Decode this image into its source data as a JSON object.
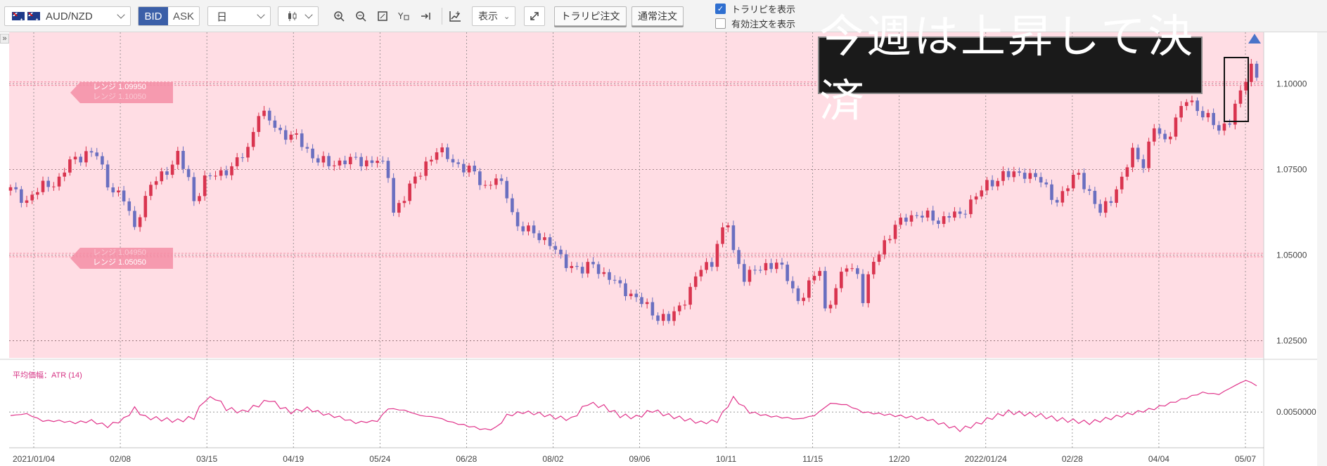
{
  "toolbar": {
    "pair": "AUD/NZD",
    "bid_label": "BID",
    "ask_label": "ASK",
    "timeframe": "日",
    "display_label": "表示",
    "trarepi_order_label": "トラリピ注文",
    "normal_order_label": "通常注文",
    "show_trarepi_label": "トラリピを表示",
    "show_trarepi_checked": true,
    "show_active_label": "有効注文を表示",
    "show_active_checked": false
  },
  "annotation": "今週は上昇して決済",
  "ranges": {
    "upper_top": "レンジ 1.09950",
    "upper_bottom": "レンジ 1.10050",
    "lower_top": "レンジ 1.04950",
    "lower_bottom": "レンジ 1.05050"
  },
  "chart_data": {
    "type": "candlestick",
    "symbol": "AUD/NZD",
    "timeframe": "日",
    "price_axis": {
      "min": 1.02,
      "max": 1.115,
      "ticks": [
        "1.02500",
        "1.05000",
        "1.07500",
        "1.10000"
      ]
    },
    "x_labels": [
      "2021/01/04",
      "02/08",
      "03/15",
      "04/19",
      "05/24",
      "06/28",
      "08/02",
      "09/06",
      "10/11",
      "11/15",
      "12/20",
      "2022/01/24",
      "02/28",
      "04/04",
      "05/07"
    ],
    "close_path": [
      [
        0,
        1.069
      ],
      [
        3,
        1.066
      ],
      [
        6,
        1.07
      ],
      [
        9,
        1.072
      ],
      [
        11,
        1.077
      ],
      [
        14,
        1.08
      ],
      [
        16,
        1.079
      ],
      [
        18,
        1.071
      ],
      [
        21,
        1.066
      ],
      [
        23,
        1.058
      ],
      [
        24,
        1.063
      ],
      [
        26,
        1.07
      ],
      [
        29,
        1.075
      ],
      [
        31,
        1.079
      ],
      [
        33,
        1.072
      ],
      [
        34,
        1.066
      ],
      [
        36,
        1.072
      ],
      [
        39,
        1.074
      ],
      [
        42,
        1.077
      ],
      [
        44,
        1.081
      ],
      [
        46,
        1.092
      ],
      [
        48,
        1.089
      ],
      [
        50,
        1.086
      ],
      [
        53,
        1.084
      ],
      [
        56,
        1.079
      ],
      [
        59,
        1.076
      ],
      [
        62,
        1.078
      ],
      [
        65,
        1.077
      ],
      [
        68,
        1.078
      ],
      [
        70,
        1.073
      ],
      [
        71,
        1.063
      ],
      [
        73,
        1.067
      ],
      [
        75,
        1.072
      ],
      [
        77,
        1.077
      ],
      [
        79,
        1.08
      ],
      [
        81,
        1.079
      ],
      [
        84,
        1.075
      ],
      [
        86,
        1.074
      ],
      [
        88,
        1.07
      ],
      [
        90,
        1.072
      ],
      [
        92,
        1.068
      ],
      [
        94,
        1.058
      ],
      [
        96,
        1.057
      ],
      [
        98,
        1.056
      ],
      [
        100,
        1.053
      ],
      [
        102,
        1.049
      ],
      [
        104,
        1.047
      ],
      [
        106,
        1.045
      ],
      [
        108,
        1.048
      ],
      [
        110,
        1.044
      ],
      [
        112,
        1.042
      ],
      [
        114,
        1.04
      ],
      [
        116,
        1.037
      ],
      [
        118,
        1.035
      ],
      [
        120,
        1.032
      ],
      [
        122,
        1.031
      ],
      [
        124,
        1.035
      ],
      [
        126,
        1.04
      ],
      [
        128,
        1.046
      ],
      [
        130,
        1.048
      ],
      [
        131,
        1.054
      ],
      [
        133,
        1.059
      ],
      [
        134,
        1.051
      ],
      [
        136,
        1.044
      ],
      [
        138,
        1.045
      ],
      [
        140,
        1.047
      ],
      [
        142,
        1.048
      ],
      [
        144,
        1.043
      ],
      [
        146,
        1.037
      ],
      [
        148,
        1.041
      ],
      [
        150,
        1.046
      ],
      [
        151,
        1.034
      ],
      [
        153,
        1.04
      ],
      [
        155,
        1.047
      ],
      [
        157,
        1.045
      ],
      [
        158,
        1.037
      ],
      [
        160,
        1.048
      ],
      [
        162,
        1.054
      ],
      [
        164,
        1.058
      ],
      [
        166,
        1.061
      ],
      [
        168,
        1.062
      ],
      [
        170,
        1.061
      ],
      [
        172,
        1.06
      ],
      [
        174,
        1.062
      ],
      [
        176,
        1.061
      ],
      [
        178,
        1.066
      ],
      [
        180,
        1.069
      ],
      [
        182,
        1.071
      ],
      [
        184,
        1.074
      ],
      [
        186,
        1.073
      ],
      [
        188,
        1.074
      ],
      [
        190,
        1.073
      ],
      [
        192,
        1.069
      ],
      [
        194,
        1.066
      ],
      [
        196,
        1.07
      ],
      [
        198,
        1.074
      ],
      [
        200,
        1.068
      ],
      [
        202,
        1.062
      ],
      [
        204,
        1.067
      ],
      [
        206,
        1.072
      ],
      [
        208,
        1.08
      ],
      [
        210,
        1.077
      ],
      [
        212,
        1.087
      ],
      [
        214,
        1.083
      ],
      [
        216,
        1.09
      ],
      [
        218,
        1.095
      ],
      [
        220,
        1.093
      ],
      [
        222,
        1.09
      ],
      [
        224,
        1.086
      ],
      [
        226,
        1.09
      ],
      [
        228,
        1.097
      ],
      [
        230,
        1.105
      ],
      [
        231,
        1.103
      ]
    ]
  },
  "atr": {
    "label": "平均価幅：ATR (14)",
    "axis_tick": "0.0050000",
    "range": [
      0.0033,
      0.0075
    ],
    "path": [
      [
        0,
        0.0048
      ],
      [
        3,
        0.0049
      ],
      [
        6,
        0.0045
      ],
      [
        9,
        0.0045
      ],
      [
        12,
        0.0044
      ],
      [
        15,
        0.0045
      ],
      [
        18,
        0.0042
      ],
      [
        21,
        0.0046
      ],
      [
        23,
        0.0052
      ],
      [
        25,
        0.0047
      ],
      [
        28,
        0.0046
      ],
      [
        31,
        0.0045
      ],
      [
        34,
        0.0047
      ],
      [
        36,
        0.0057
      ],
      [
        38,
        0.0058
      ],
      [
        40,
        0.0052
      ],
      [
        43,
        0.005
      ],
      [
        46,
        0.0054
      ],
      [
        48,
        0.0057
      ],
      [
        50,
        0.0053
      ],
      [
        52,
        0.005
      ],
      [
        55,
        0.0052
      ],
      [
        58,
        0.0049
      ],
      [
        61,
        0.0047
      ],
      [
        64,
        0.0044
      ],
      [
        68,
        0.0045
      ],
      [
        70,
        0.0052
      ],
      [
        73,
        0.0051
      ],
      [
        76,
        0.0048
      ],
      [
        79,
        0.0047
      ],
      [
        82,
        0.0044
      ],
      [
        85,
        0.0042
      ],
      [
        88,
        0.004
      ],
      [
        90,
        0.0041
      ],
      [
        92,
        0.0048
      ],
      [
        95,
        0.005
      ],
      [
        98,
        0.0049
      ],
      [
        101,
        0.0047
      ],
      [
        104,
        0.0046
      ],
      [
        107,
        0.0055
      ],
      [
        110,
        0.0053
      ],
      [
        113,
        0.0048
      ],
      [
        116,
        0.0047
      ],
      [
        119,
        0.0051
      ],
      [
        122,
        0.0048
      ],
      [
        125,
        0.0046
      ],
      [
        128,
        0.0044
      ],
      [
        131,
        0.0045
      ],
      [
        134,
        0.0058
      ],
      [
        137,
        0.005
      ],
      [
        140,
        0.0048
      ],
      [
        143,
        0.0047
      ],
      [
        146,
        0.0046
      ],
      [
        149,
        0.0048
      ],
      [
        152,
        0.0055
      ],
      [
        155,
        0.0054
      ],
      [
        158,
        0.005
      ],
      [
        161,
        0.0049
      ],
      [
        164,
        0.0048
      ],
      [
        167,
        0.0047
      ],
      [
        170,
        0.0046
      ],
      [
        173,
        0.0043
      ],
      [
        176,
        0.004
      ],
      [
        179,
        0.0043
      ],
      [
        182,
        0.0047
      ],
      [
        185,
        0.005
      ],
      [
        188,
        0.0049
      ],
      [
        191,
        0.0048
      ],
      [
        194,
        0.0046
      ],
      [
        197,
        0.0045
      ],
      [
        200,
        0.0044
      ],
      [
        203,
        0.0046
      ],
      [
        206,
        0.0048
      ],
      [
        209,
        0.005
      ],
      [
        212,
        0.0052
      ],
      [
        215,
        0.0055
      ],
      [
        218,
        0.0058
      ],
      [
        221,
        0.0061
      ],
      [
        224,
        0.006
      ],
      [
        227,
        0.0065
      ],
      [
        229,
        0.0068
      ],
      [
        231,
        0.0065
      ]
    ]
  }
}
